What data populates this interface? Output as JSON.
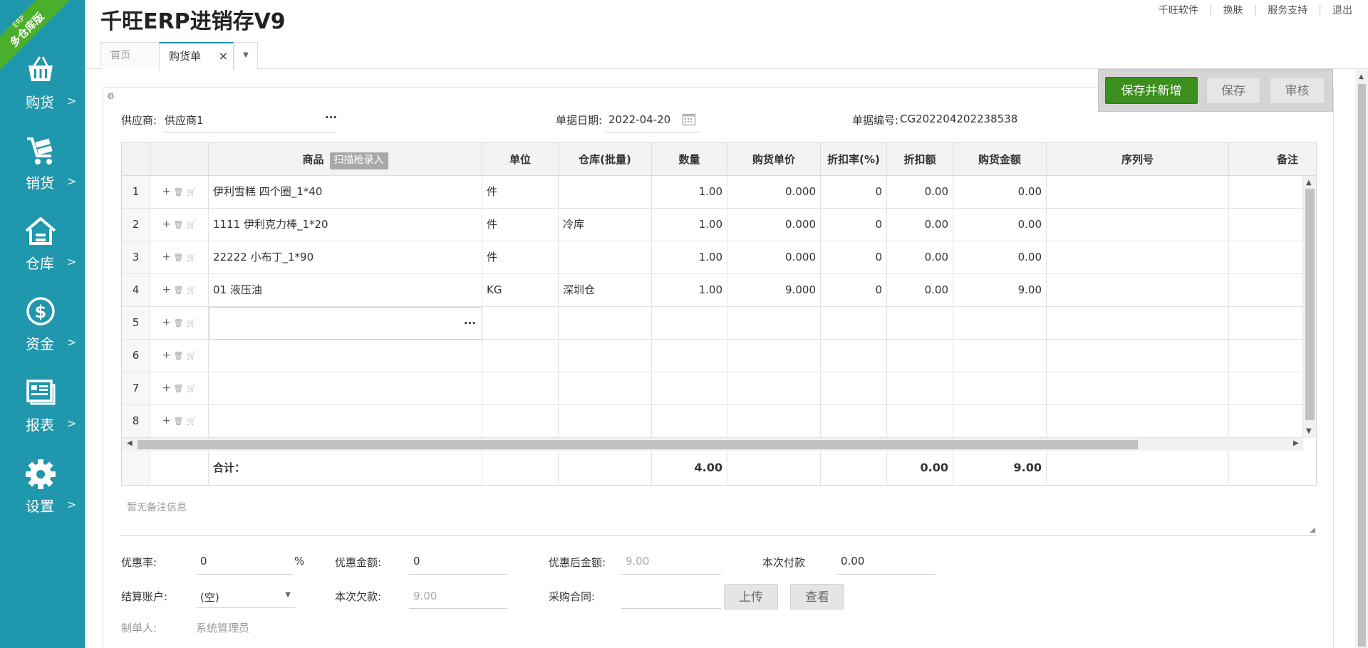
{
  "sidebar": {
    "badge_erp": "ERP",
    "badge_text": "多仓库版",
    "items": [
      {
        "label": "购货",
        "icon": "basket-icon"
      },
      {
        "label": "销货",
        "icon": "cart-icon"
      },
      {
        "label": "仓库",
        "icon": "warehouse-icon"
      },
      {
        "label": "资金",
        "icon": "dollar-icon"
      },
      {
        "label": "报表",
        "icon": "report-icon"
      },
      {
        "label": "设置",
        "icon": "gear-icon"
      }
    ],
    "arrow": ">",
    "bg_color": "#1f97ad"
  },
  "header": {
    "title": "千旺ERP进销存V9",
    "links": [
      "千旺软件",
      "换肤",
      "服务支持",
      "退出"
    ],
    "sep": "|"
  },
  "tabs": {
    "home": "首页",
    "active": "购货单",
    "close": "×",
    "more": "▼"
  },
  "actions": {
    "save_new": "保存并新增",
    "save": "保存",
    "audit": "审核"
  },
  "form": {
    "supplier_label": "供应商:",
    "supplier_value": "供应商1",
    "supplier_more": "···",
    "date_label": "单据日期:",
    "date_value": "2022-04-20",
    "docno_label": "单据编号:",
    "docno_value": "CG202204202238538"
  },
  "grid": {
    "headers": {
      "product": "商品",
      "scan": "扫描枪录入",
      "unit": "单位",
      "warehouse": "仓库(批量)",
      "qty": "数量",
      "price": "购货单价",
      "discount_rate": "折扣率(%)",
      "discount_amt": "折扣额",
      "amount": "购货金额",
      "serial": "序列号",
      "note": "备注"
    },
    "op_icons": [
      "+",
      "🗑",
      "🛒"
    ],
    "rows": [
      {
        "n": "1",
        "product": "伊利雪糕 四个圈_1*40",
        "unit": "件",
        "warehouse": "",
        "qty": "1.00",
        "price": "0.000",
        "rate": "0",
        "disc": "0.00",
        "amount": "0.00"
      },
      {
        "n": "2",
        "product": "1111 伊利克力棒_1*20",
        "unit": "件",
        "warehouse": "冷库",
        "qty": "1.00",
        "price": "0.000",
        "rate": "0",
        "disc": "0.00",
        "amount": "0.00"
      },
      {
        "n": "3",
        "product": "22222 小布丁_1*90",
        "unit": "件",
        "warehouse": "",
        "qty": "1.00",
        "price": "0.000",
        "rate": "0",
        "disc": "0.00",
        "amount": "0.00"
      },
      {
        "n": "4",
        "product": "01 液压油",
        "unit": "KG",
        "warehouse": "深圳仓",
        "qty": "1.00",
        "price": "9.000",
        "rate": "0",
        "disc": "0.00",
        "amount": "9.00"
      },
      {
        "n": "5",
        "product": "",
        "unit": "",
        "warehouse": "",
        "qty": "",
        "price": "",
        "rate": "",
        "disc": "",
        "amount": ""
      },
      {
        "n": "6",
        "product": "",
        "unit": "",
        "warehouse": "",
        "qty": "",
        "price": "",
        "rate": "",
        "disc": "",
        "amount": ""
      },
      {
        "n": "7",
        "product": "",
        "unit": "",
        "warehouse": "",
        "qty": "",
        "price": "",
        "rate": "",
        "disc": "",
        "amount": ""
      },
      {
        "n": "8",
        "product": "",
        "unit": "",
        "warehouse": "",
        "qty": "",
        "price": "",
        "rate": "",
        "disc": "",
        "amount": ""
      }
    ],
    "editing_more": "···",
    "totals": {
      "label": "合计：",
      "qty": "4.00",
      "disc": "0.00",
      "amount": "9.00"
    }
  },
  "remarks": {
    "placeholder": "暂无备注信息"
  },
  "footer": {
    "discount_rate_label": "优惠率:",
    "discount_rate_value": "0",
    "percent": "%",
    "discount_amt_label": "优惠金额:",
    "discount_amt_value": "0",
    "after_discount_label": "优惠后金额:",
    "after_discount_value": "9.00",
    "pay_label": "本次付款",
    "pay_value": "0.00",
    "account_label": "结算账户:",
    "account_value": "(空)",
    "owe_label": "本次欠款:",
    "owe_value": "9.00",
    "contract_label": "采购合同:",
    "upload": "上传",
    "view": "查看",
    "maker_label": "制单人:",
    "maker_value": "系统管理员"
  }
}
